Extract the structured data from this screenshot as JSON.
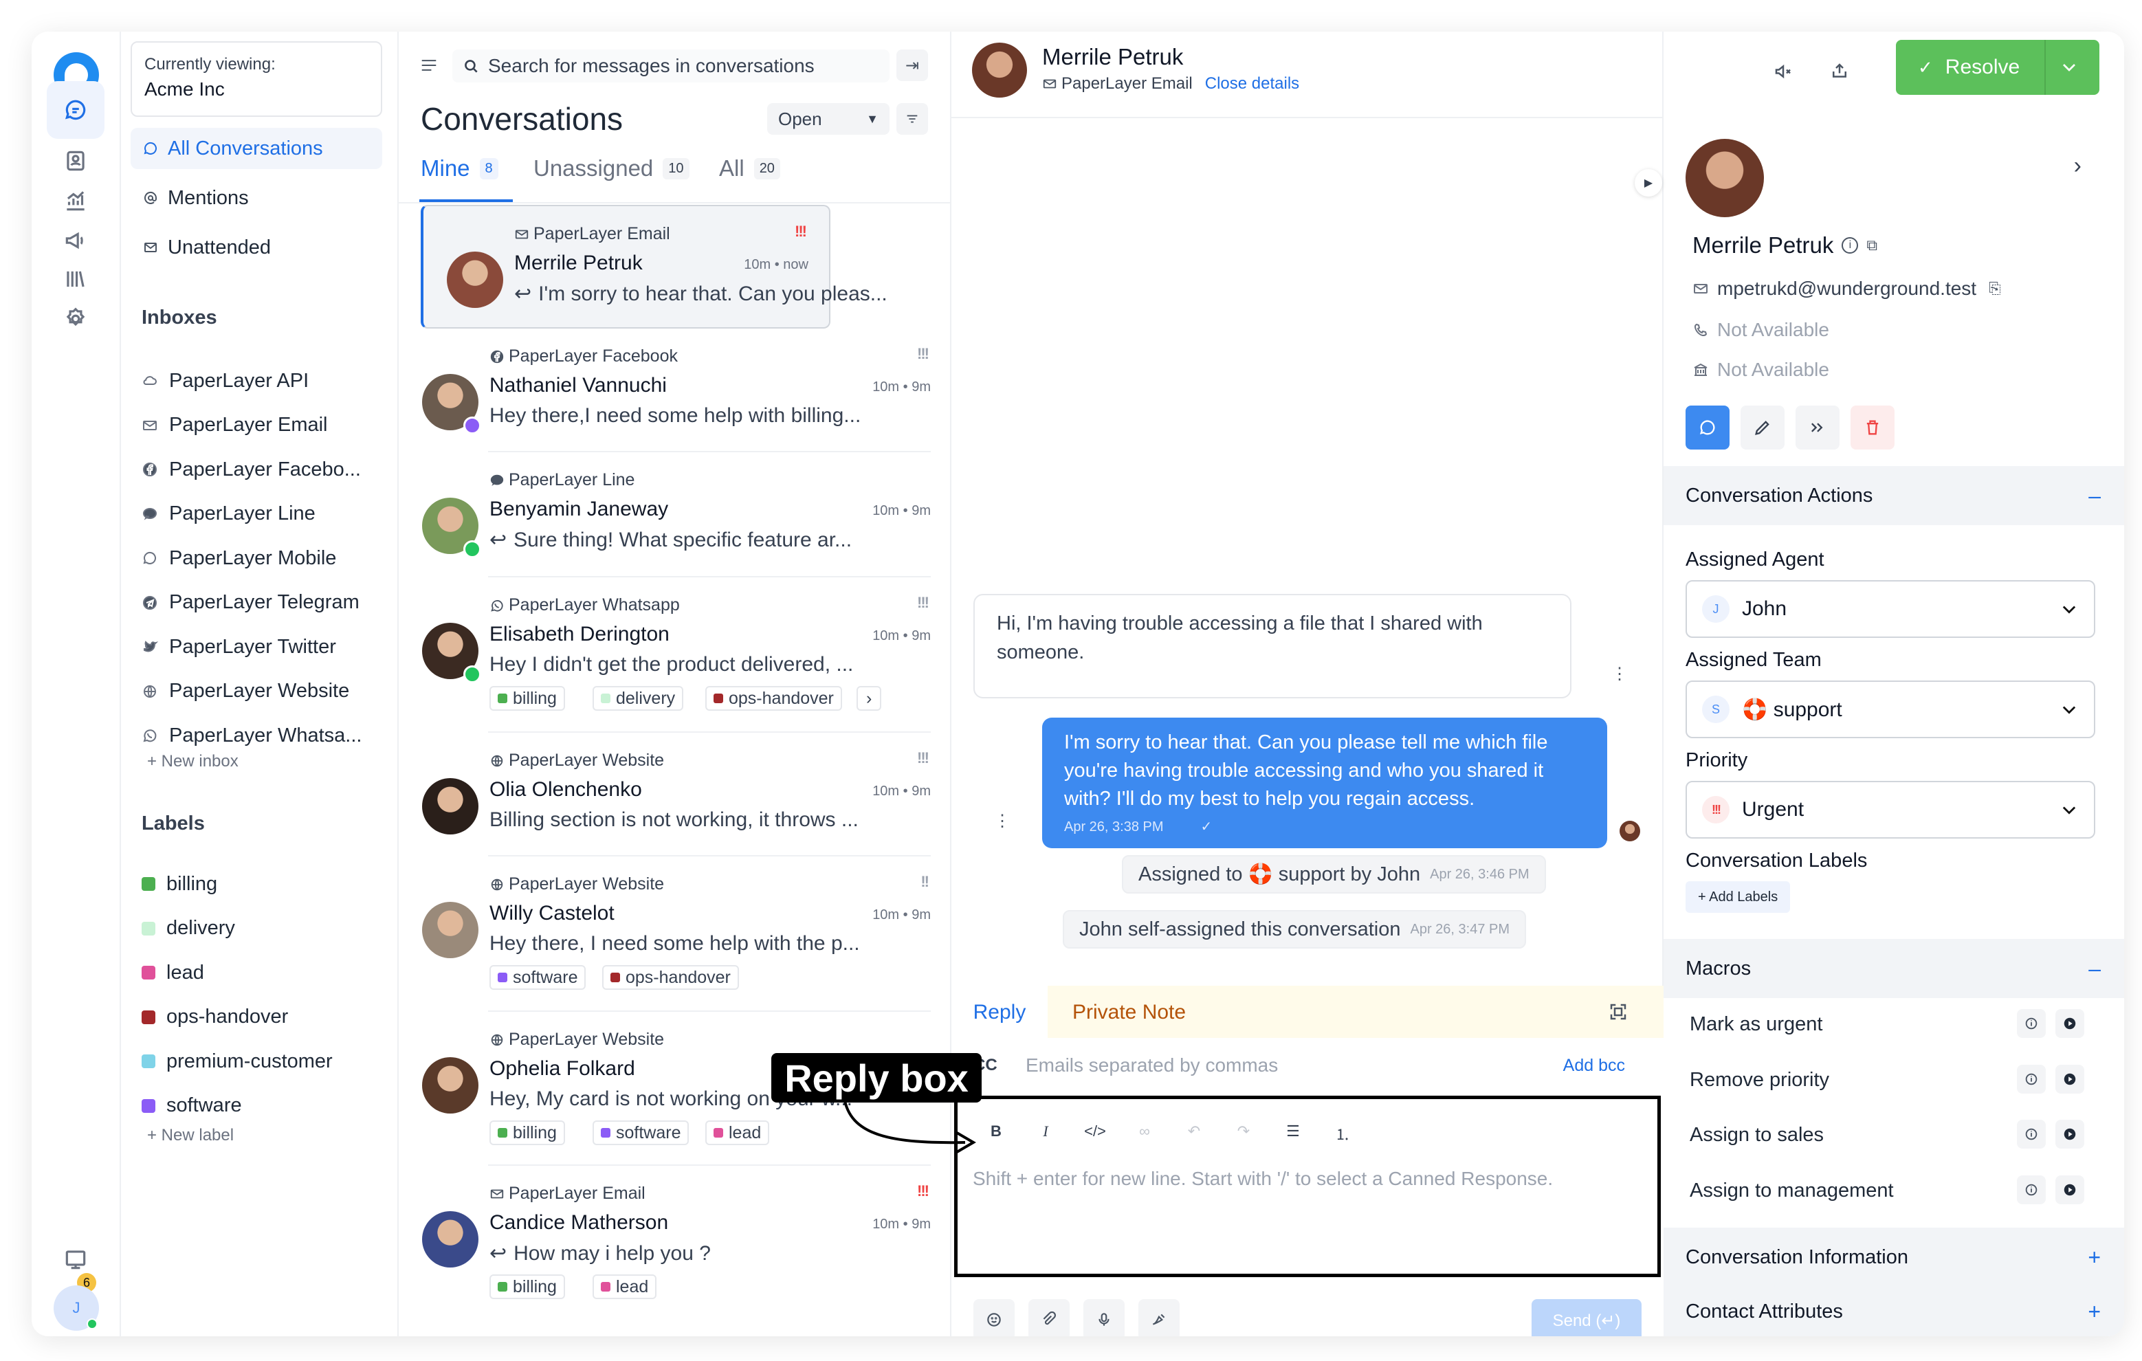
{
  "rail": {
    "items": [
      {
        "name": "conversations-icon",
        "active": true
      },
      {
        "name": "contacts-icon",
        "active": false
      },
      {
        "name": "reports-icon",
        "active": false
      },
      {
        "name": "campaigns-icon",
        "active": false
      },
      {
        "name": "library-icon",
        "active": false
      },
      {
        "name": "settings-icon",
        "active": false
      }
    ],
    "notification_count": "6",
    "user_initial": "J"
  },
  "sidebar": {
    "viewing_label": "Currently viewing:",
    "account": "Acme Inc",
    "nav": [
      {
        "label": "All Conversations",
        "icon": "chat-icon",
        "active": true
      },
      {
        "label": "Mentions",
        "icon": "at-icon",
        "active": false
      },
      {
        "label": "Unattended",
        "icon": "inbox-icon",
        "active": false
      }
    ],
    "inboxes_heading": "Inboxes",
    "inboxes": [
      {
        "label": "PaperLayer API",
        "icon": "cloud-icon"
      },
      {
        "label": "PaperLayer Email",
        "icon": "mail-icon"
      },
      {
        "label": "PaperLayer Facebo...",
        "icon": "facebook-icon"
      },
      {
        "label": "PaperLayer Line",
        "icon": "line-icon"
      },
      {
        "label": "PaperLayer Mobile",
        "icon": "sms-icon"
      },
      {
        "label": "PaperLayer Telegram",
        "icon": "telegram-icon"
      },
      {
        "label": "PaperLayer Twitter",
        "icon": "twitter-icon"
      },
      {
        "label": "PaperLayer Website",
        "icon": "globe-icon"
      },
      {
        "label": "PaperLayer Whatsa...",
        "icon": "whatsapp-icon"
      }
    ],
    "new_inbox": "+ New inbox",
    "labels_heading": "Labels",
    "labels": [
      {
        "label": "billing",
        "color": "#4caf50"
      },
      {
        "label": "delivery",
        "color": "#c9f2d5"
      },
      {
        "label": "lead",
        "color": "#e0519a"
      },
      {
        "label": "ops-handover",
        "color": "#a3282a"
      },
      {
        "label": "premium-customer",
        "color": "#7fd3e8"
      },
      {
        "label": "software",
        "color": "#8b5cf6"
      }
    ],
    "new_label": "+ New label"
  },
  "list": {
    "search_placeholder": "Search for messages in conversations",
    "title": "Conversations",
    "status": "Open",
    "tabs": [
      {
        "label": "Mine",
        "count": "8",
        "active": true
      },
      {
        "label": "Unassigned",
        "count": "10",
        "active": false
      },
      {
        "label": "All",
        "count": "20",
        "active": false
      }
    ],
    "conversations": [
      {
        "inbox": "PaperLayer Email",
        "inbox_icon": "mail-icon",
        "name": "Merrile Petruk",
        "time": "10m • now",
        "msg": "I'm sorry to hear that. Can you pleas...",
        "reply": true,
        "prio": "!!!",
        "prio_color": "#ef4444",
        "labels": [],
        "avatar": "#8a4a3a",
        "badge": ""
      },
      {
        "inbox": "PaperLayer Facebook",
        "inbox_icon": "facebook-icon",
        "name": "Nathaniel Vannuchi",
        "time": "10m • 9m",
        "msg": "Hey there,I need some help with billing...",
        "reply": false,
        "prio": "!!!",
        "prio_color": "#9ca3af",
        "labels": [],
        "avatar": "#6b5b4e",
        "badge": "#8b5cf6"
      },
      {
        "inbox": "PaperLayer Line",
        "inbox_icon": "line-icon",
        "name": "Benyamin Janeway",
        "time": "10m • 9m",
        "msg": "Sure thing! What specific feature ar...",
        "reply": true,
        "prio": "",
        "prio_color": "",
        "labels": [],
        "avatar": "#7a9a5a",
        "badge": "#22c55e"
      },
      {
        "inbox": "PaperLayer Whatsapp",
        "inbox_icon": "whatsapp-icon",
        "name": "Elisabeth Derington",
        "time": "10m • 9m",
        "msg": "Hey I didn't get the product delivered, ...",
        "reply": false,
        "prio": "!!!",
        "prio_color": "#9ca3af",
        "labels": [
          {
            "label": "billing",
            "color": "#4caf50"
          },
          {
            "label": "delivery",
            "color": "#c9f2d5"
          },
          {
            "label": "ops-handover",
            "color": "#a3282a"
          }
        ],
        "more": true,
        "avatar": "#3b2a22",
        "badge": "#22c55e"
      },
      {
        "inbox": "PaperLayer Website",
        "inbox_icon": "globe-icon",
        "name": "Olia Olenchenko",
        "time": "10m • 9m",
        "msg": "Billing section is not working, it throws ...",
        "reply": false,
        "prio": "!!!",
        "prio_color": "#9ca3af",
        "labels": [],
        "avatar": "#2a1f1a",
        "badge": ""
      },
      {
        "inbox": "PaperLayer Website",
        "inbox_icon": "globe-icon",
        "name": "Willy Castelot",
        "time": "10m • 9m",
        "msg": "Hey there, I need some help with the p...",
        "reply": false,
        "prio": "!!",
        "prio_color": "#9ca3af",
        "labels": [
          {
            "label": "software",
            "color": "#8b5cf6"
          },
          {
            "label": "ops-handover",
            "color": "#a3282a"
          }
        ],
        "avatar": "#9a8a7a",
        "badge": ""
      },
      {
        "inbox": "PaperLayer Website",
        "inbox_icon": "globe-icon",
        "name": "Ophelia Folkard",
        "time": "",
        "msg": "Hey, My card is not working on your w...",
        "reply": false,
        "prio": "",
        "prio_color": "",
        "labels": [
          {
            "label": "billing",
            "color": "#4caf50"
          },
          {
            "label": "software",
            "color": "#8b5cf6"
          },
          {
            "label": "lead",
            "color": "#e0519a"
          }
        ],
        "avatar": "#5a3a2a",
        "badge": ""
      },
      {
        "inbox": "PaperLayer Email",
        "inbox_icon": "mail-icon",
        "name": "Candice Matherson",
        "time": "10m • 9m",
        "msg": "How may i help you ?",
        "reply": true,
        "prio": "!!!",
        "prio_color": "#ef4444",
        "labels": [
          {
            "label": "billing",
            "color": "#4caf50"
          },
          {
            "label": "lead",
            "color": "#e0519a"
          }
        ],
        "avatar": "#3a4a8a",
        "badge": ""
      }
    ]
  },
  "chat": {
    "contact_name": "Merrile Petruk",
    "inbox": "PaperLayer Email",
    "close_details": "Close details",
    "resolve": "Resolve",
    "incoming": "Hi, I'm having trouble accessing a file that I shared with someone.",
    "outgoing": "I'm sorry to hear that. Can you please tell me which file you're having trouble accessing and who you shared it with? I'll do my best to help you regain access.",
    "outgoing_time": "Apr 26, 3:38 PM",
    "activities": [
      {
        "text": "Assigned to 🛟 support by John",
        "time": "Apr 26, 3:46 PM"
      },
      {
        "text": "John self-assigned this conversation",
        "time": "Apr 26, 3:47 PM"
      }
    ],
    "reply_tab": "Reply",
    "note_tab": "Private Note",
    "cc_label": "CC",
    "cc_placeholder": "Emails separated by commas",
    "add_bcc": "Add bcc",
    "editor_placeholder": "Shift + enter for new line. Start with '/' to select a Canned Response.",
    "send": "Send (↵)",
    "callout": "Reply box"
  },
  "panel": {
    "name": "Merrile Petruk",
    "email": "mpetrukd@wunderground.test",
    "phone": "Not Available",
    "company": "Not Available",
    "actions_heading": "Conversation Actions",
    "assigned_agent_label": "Assigned Agent",
    "assigned_agent": "John",
    "agent_initial": "J",
    "assigned_team_label": "Assigned Team",
    "assigned_team": "🛟 support",
    "team_initial": "S",
    "priority_label": "Priority",
    "priority": "Urgent",
    "labels_label": "Conversation Labels",
    "add_labels": "+ Add Labels",
    "macros_heading": "Macros",
    "macros": [
      "Mark as urgent",
      "Remove priority",
      "Assign to sales",
      "Assign to management"
    ],
    "info_heading": "Conversation Information",
    "attrs_heading": "Contact Attributes"
  }
}
